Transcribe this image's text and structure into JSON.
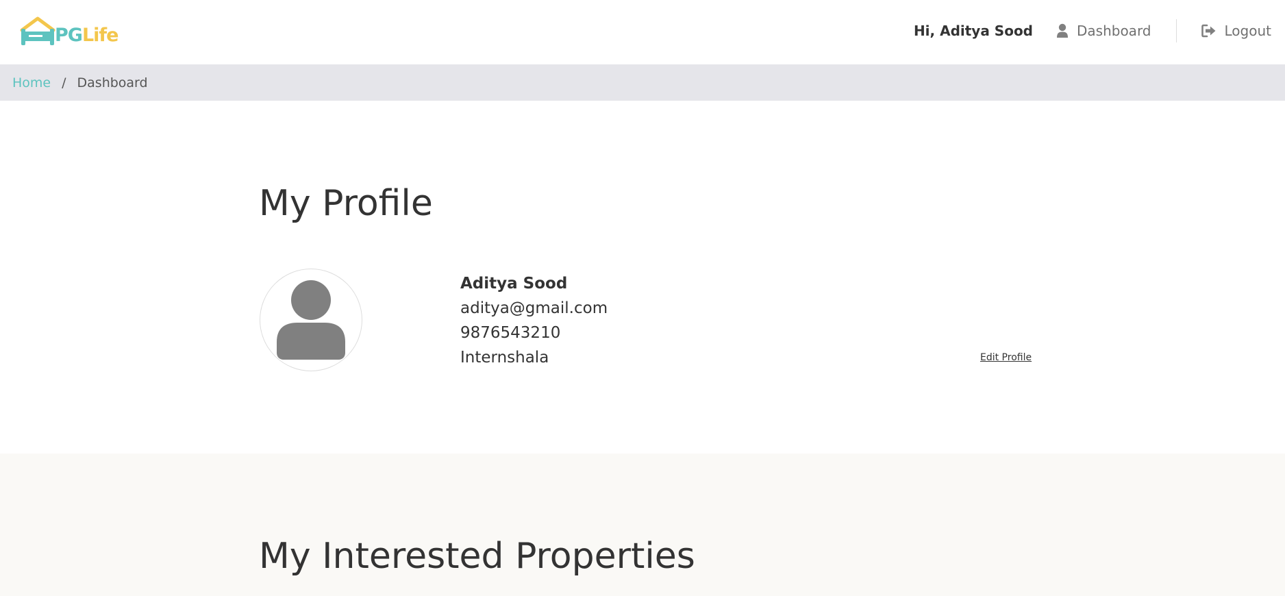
{
  "header": {
    "logo": {
      "text_pg": "PG",
      "text_life": "Life",
      "icon": "house-bed-icon"
    },
    "greeting": "Hi, Aditya Sood",
    "dashboard_label": "Dashboard",
    "logout_label": "Logout",
    "dashboard_icon": "user-icon",
    "logout_icon": "sign-out-icon"
  },
  "breadcrumb": {
    "home": "Home",
    "separator": "/",
    "current": "Dashboard"
  },
  "profile": {
    "title": "My Profile",
    "avatar_icon": "user-avatar-icon",
    "name": "Aditya Sood",
    "email": "aditya@gmail.com",
    "phone": "9876543210",
    "college": "Internshala",
    "edit_label": "Edit Profile"
  },
  "interested": {
    "title": "My Interested Properties"
  },
  "colors": {
    "brand_teal": "#5dc3bf",
    "brand_yellow": "#f3c64c",
    "breadcrumb_bg": "#e5e5ea",
    "section_alt_bg": "#faf9f6",
    "text_dark": "#333333",
    "icon_gray": "#808080"
  }
}
